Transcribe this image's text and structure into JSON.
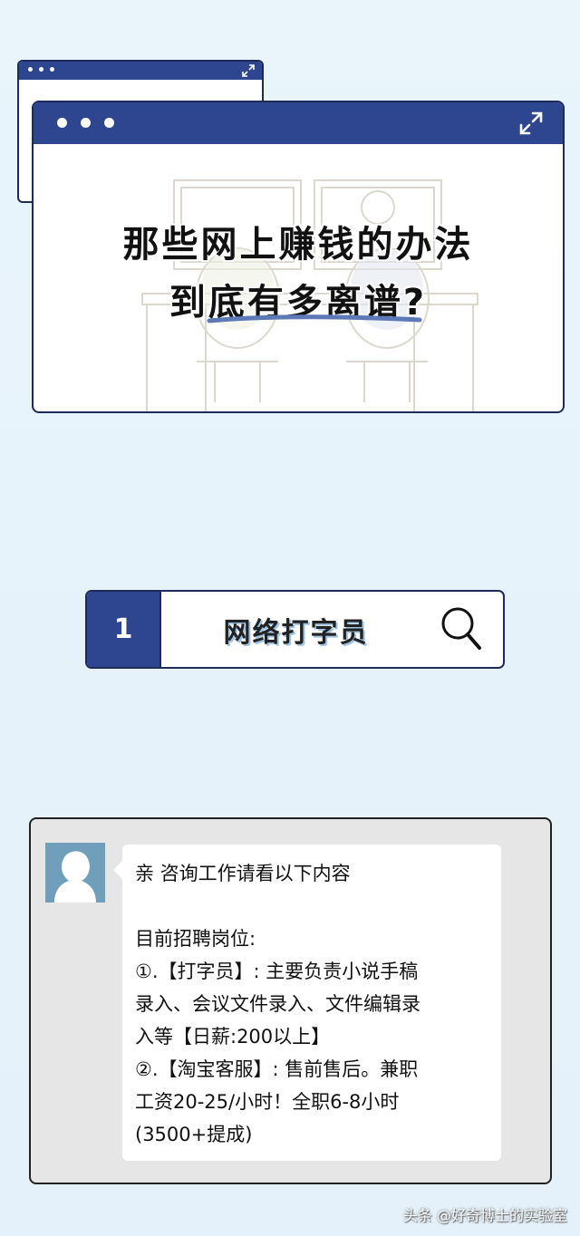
{
  "hero": {
    "title_line1": "那些网上赚钱的办法",
    "title_line2": "到底有多离谱?"
  },
  "section": {
    "number": "1",
    "title": "网络打字员"
  },
  "chat": {
    "lines": [
      "亲 咨询工作请看以下内容",
      "",
      "目前招聘岗位:",
      "①.【打字员】: 主要负责小说手稿",
      "录入、会议文件录入、文件编辑录",
      "入等【日薪:200以上】",
      "②.【淘宝客服】: 售前售后。兼职",
      "工资20-25/小时！全职6-8小时",
      "(3500+提成)"
    ]
  },
  "watermark": "头条 @好奇博士的实验室",
  "colors": {
    "accent_navy": "#2e4590",
    "background": "#e6f2fb",
    "avatar": "#6f9fba"
  },
  "icons": [
    "expand-icon",
    "search-icon",
    "avatar-silhouette-icon"
  ]
}
